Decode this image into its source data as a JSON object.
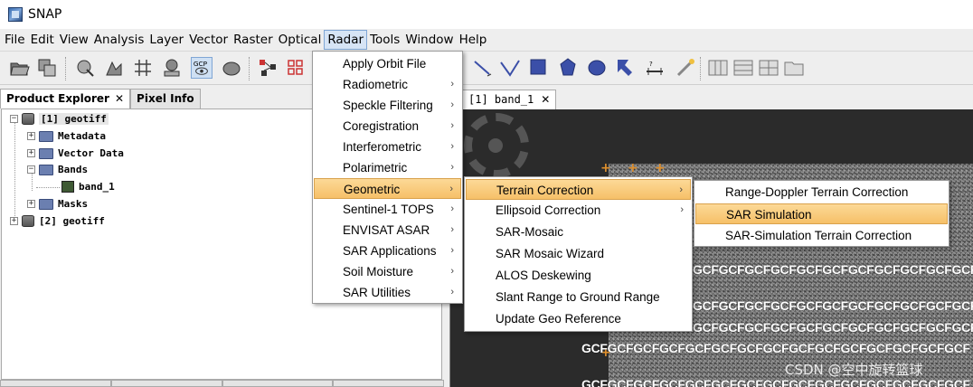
{
  "window": {
    "title": "SNAP"
  },
  "menubar": [
    "File",
    "Edit",
    "View",
    "Analysis",
    "Layer",
    "Vector",
    "Raster",
    "Optical",
    "Radar",
    "Tools",
    "Window",
    "Help"
  ],
  "left_panel": {
    "tabs": [
      {
        "label": "Product Explorer",
        "close": "✕"
      },
      {
        "label": "Pixel Info"
      }
    ],
    "tree": {
      "product1": "[1] geotiff",
      "metadata": "Metadata",
      "vector_data": "Vector Data",
      "bands": "Bands",
      "band_1": "band_1",
      "masks": "Masks",
      "product2": "[2] geotiff"
    }
  },
  "image_view": {
    "tab": {
      "label": "[1] band_1",
      "close": "✕"
    },
    "gcp_text": "GCFGCFGCFGCFGCFGCFGCFGCFGCFGCFGCFGCFGCFGCFGCF"
  },
  "radar_menu": {
    "items": [
      {
        "label": "Apply Orbit File",
        "submenu": false
      },
      {
        "label": "Radiometric",
        "submenu": true
      },
      {
        "label": "Speckle Filtering",
        "submenu": true
      },
      {
        "label": "Coregistration",
        "submenu": true
      },
      {
        "label": "Interferometric",
        "submenu": true
      },
      {
        "label": "Polarimetric",
        "submenu": true
      },
      {
        "label": "Geometric",
        "submenu": true,
        "selected": true
      },
      {
        "label": "Sentinel-1 TOPS",
        "submenu": true
      },
      {
        "label": "ENVISAT ASAR",
        "submenu": true
      },
      {
        "label": "SAR Applications",
        "submenu": true
      },
      {
        "label": "Soil Moisture",
        "submenu": true
      },
      {
        "label": "SAR Utilities",
        "submenu": true
      }
    ]
  },
  "geometric_menu": {
    "items": [
      {
        "label": "Terrain Correction",
        "submenu": true,
        "selected": true
      },
      {
        "label": "Ellipsoid Correction",
        "submenu": true
      },
      {
        "label": "SAR-Mosaic",
        "submenu": false
      },
      {
        "label": "SAR Mosaic Wizard",
        "submenu": false
      },
      {
        "label": "ALOS Deskewing",
        "submenu": false
      },
      {
        "label": "Slant Range to Ground Range",
        "submenu": false
      },
      {
        "label": "Update Geo Reference",
        "submenu": false
      }
    ]
  },
  "terrain_menu": {
    "items": [
      {
        "label": "Range-Doppler Terrain Correction"
      },
      {
        "label": "SAR Simulation",
        "selected": true
      },
      {
        "label": "SAR-Simulation Terrain Correction"
      }
    ]
  },
  "submenu_arrow": "›",
  "watermark": "CSDN @空中旋转篮球",
  "colors": {
    "menu_highlight": "#f8c66f",
    "active_menu": "#d6e4f5"
  }
}
